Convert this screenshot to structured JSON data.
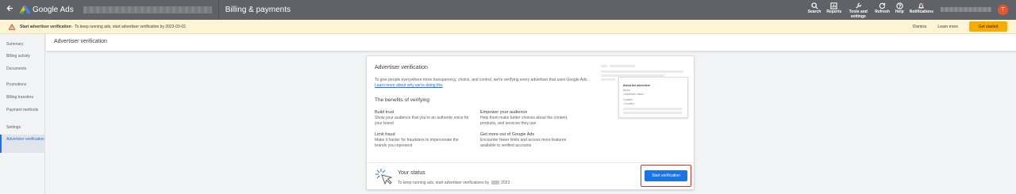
{
  "header": {
    "product_name": "Google Ads",
    "page_title": "Billing & payments",
    "tools": [
      {
        "label": "Search",
        "icon": "search-icon"
      },
      {
        "label": "Reports",
        "icon": "reports-icon"
      },
      {
        "label": "Tools and settings",
        "icon": "wrench-icon"
      },
      {
        "label": "Refresh",
        "icon": "refresh-icon"
      },
      {
        "label": "Help",
        "icon": "help-icon"
      },
      {
        "label": "Notifications",
        "icon": "bell-icon"
      }
    ],
    "avatar_initial": "T"
  },
  "banner": {
    "title": "Start advertiser verification",
    "message": " · To keep running ads, start advertiser verification by 2023-03-02.",
    "dismiss_label": "Dismiss",
    "learn_more_label": "Learn more",
    "get_started_label": "Get started",
    "accent_color": "#f9ab00"
  },
  "sidebar": {
    "items": [
      {
        "label": "Summary"
      },
      {
        "label": "Billing activity"
      },
      {
        "label": "Documents"
      },
      {
        "label": "Promotions"
      },
      {
        "label": "Billing transfers"
      },
      {
        "label": "Payment methods"
      },
      {
        "label": "Settings"
      },
      {
        "label": "Advertiser verification",
        "active": true
      }
    ]
  },
  "section_header": "Advertiser verification",
  "card": {
    "title": "Advertiser verification",
    "intro": "To give people everywhere more transparency, choice, and control, we're verifying every advertiser that uses Google Ads. ",
    "intro_link": "Learn more about why we're doing this",
    "benefits_title": "The benefits of verifying",
    "benefits": [
      {
        "title": "Build trust",
        "desc": "Show your audience that you're an authentic voice for your brand"
      },
      {
        "title": "Empower your audience",
        "desc": "Help them make better choices about the content, products, and services they use"
      },
      {
        "title": "Limit fraud",
        "desc": "Make it harder for fraudsters to impersonate the brands you represent"
      },
      {
        "title": "Get more out of Google Ads",
        "desc": "Encounter fewer limits and access more features available to verified accounts"
      }
    ],
    "preview": {
      "heading": "About the advertiser",
      "name_label": "Name",
      "name_value": "<Advertiser name>",
      "location_label": "Location",
      "location_value": "<Country>"
    },
    "status": {
      "title": "Your status",
      "desc_prefix": "To keep running ads, start advertiser verifications by",
      "desc_suffix": "2023",
      "button_label": "Start verification"
    }
  }
}
